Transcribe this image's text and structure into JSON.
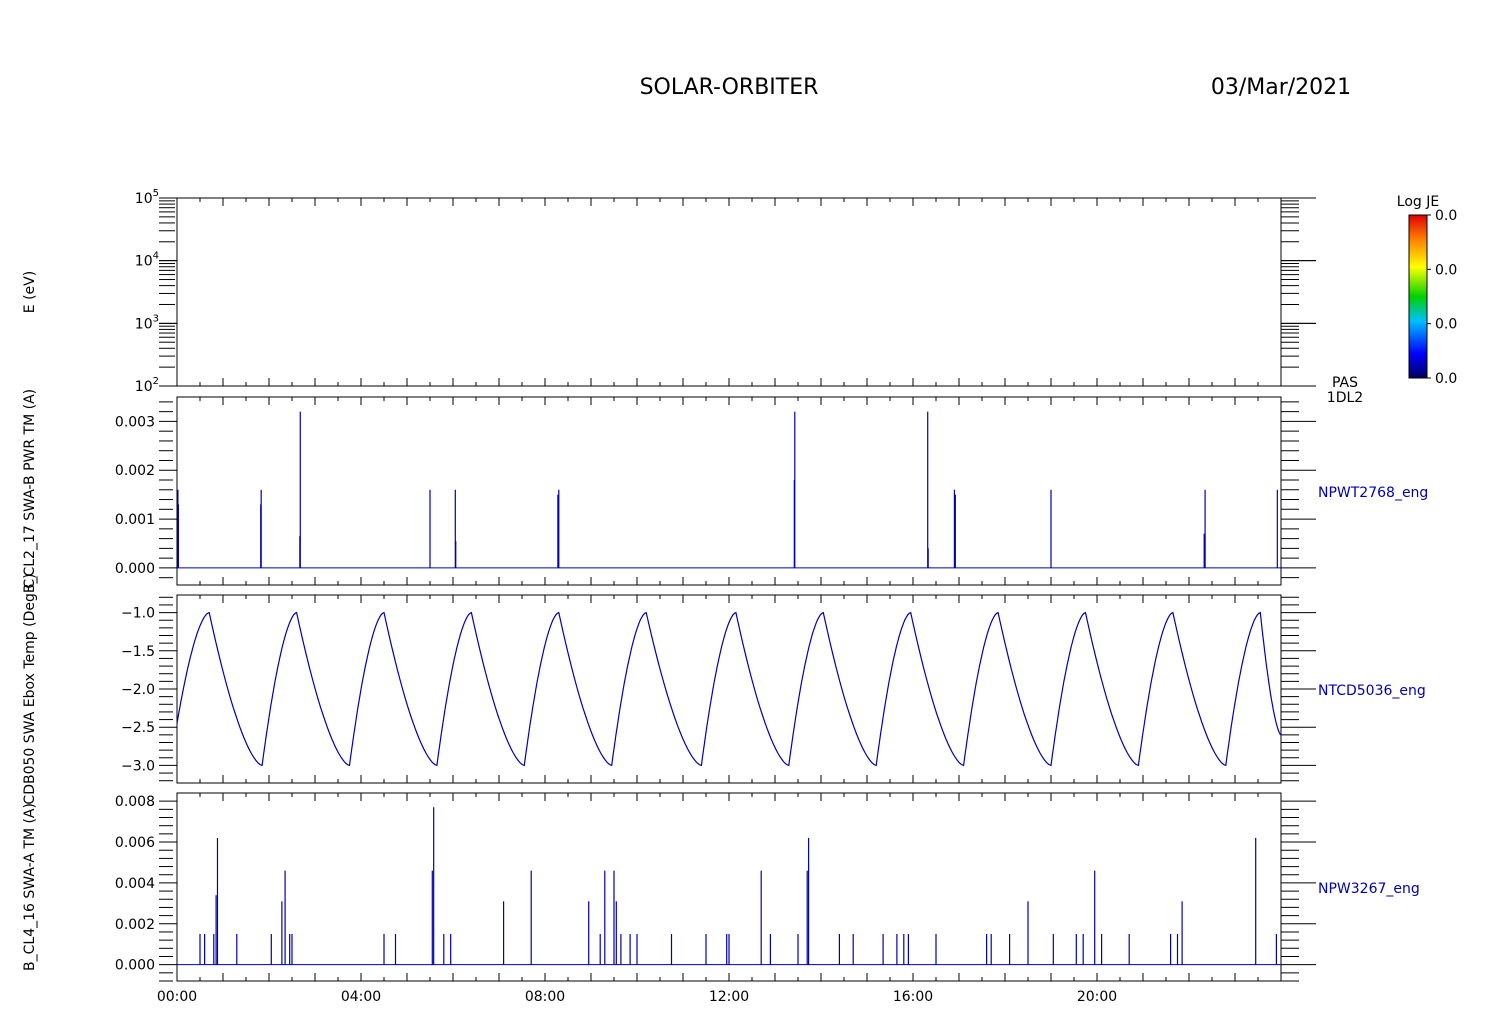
{
  "header": {
    "title": "SOLAR-ORBITER",
    "date": "03/Mar/2021"
  },
  "colors": {
    "series": "#0000b4",
    "axis": "#000000",
    "background": "#ffffff"
  },
  "chart_data": [
    {
      "type": "heatmap",
      "ylabel": "E (eV)",
      "yscale": "log",
      "ylim": [
        100,
        100000
      ],
      "ytick_labels": [
        {
          "base": "10",
          "exp": "2"
        },
        {
          "base": "10",
          "exp": "3"
        },
        {
          "base": "10",
          "exp": "4"
        },
        {
          "base": "10",
          "exp": "5"
        }
      ],
      "instrument_label": [
        "PAS",
        "1DL2"
      ],
      "colorbar": {
        "title": "Log JE",
        "tick_labels": [
          "0.0",
          "0.0",
          "0.0",
          "0.0"
        ]
      },
      "values": []
    },
    {
      "type": "line",
      "ylabel": "B_CL2_17 SWA-B PWR TM (A)",
      "series_name": "NPWT2768_eng",
      "ylim": [
        -0.00035,
        0.0035
      ],
      "yticks": [
        0.0,
        0.001,
        0.002,
        0.003
      ],
      "ytick_labels": [
        "0.000",
        "0.001",
        "0.002",
        "0.003"
      ],
      "baseline": 0.0,
      "spikes": [
        {
          "t": 0.02,
          "v": 0.0016
        },
        {
          "t": 0.03,
          "v": 0.0013
        },
        {
          "t": 1.83,
          "v": 0.0016
        },
        {
          "t": 1.82,
          "v": 0.0013
        },
        {
          "t": 2.68,
          "v": 0.0032
        },
        {
          "t": 2.67,
          "v": 0.00065
        },
        {
          "t": 5.5,
          "v": 0.0016
        },
        {
          "t": 6.05,
          "v": 0.0016
        },
        {
          "t": 6.06,
          "v": 0.00055
        },
        {
          "t": 8.3,
          "v": 0.0016
        },
        {
          "t": 8.28,
          "v": 0.0015
        },
        {
          "t": 13.43,
          "v": 0.0032
        },
        {
          "t": 13.42,
          "v": 0.0018
        },
        {
          "t": 16.32,
          "v": 0.0032
        },
        {
          "t": 16.33,
          "v": 0.0004
        },
        {
          "t": 16.9,
          "v": 0.0016
        },
        {
          "t": 16.92,
          "v": 0.0015
        },
        {
          "t": 19.0,
          "v": 0.0016
        },
        {
          "t": 22.35,
          "v": 0.0016
        },
        {
          "t": 22.33,
          "v": 0.0007
        },
        {
          "t": 23.92,
          "v": 0.0016
        }
      ]
    },
    {
      "type": "line",
      "ylabel": "CDB050 SWA Ebox Temp (Deg C)",
      "series_name": "NTCD5036_eng",
      "ylim": [
        -3.23,
        -0.77
      ],
      "yticks": [
        -3.0,
        -2.5,
        -2.0,
        -1.5,
        -1.0
      ],
      "ytick_labels": [
        "−3.0",
        "−2.5",
        "−2.0",
        "−1.5",
        "−1.0"
      ],
      "start": {
        "t": 0.0,
        "v": -2.45
      },
      "end": {
        "t": 24.0,
        "v": -2.6
      },
      "peaks": [
        {
          "t": 0.7,
          "v": -1.0
        },
        {
          "t": 2.6,
          "v": -1.0
        },
        {
          "t": 4.5,
          "v": -1.0
        },
        {
          "t": 6.4,
          "v": -1.0
        },
        {
          "t": 8.3,
          "v": -1.0
        },
        {
          "t": 10.2,
          "v": -1.0
        },
        {
          "t": 12.15,
          "v": -1.0
        },
        {
          "t": 14.05,
          "v": -1.0
        },
        {
          "t": 15.95,
          "v": -1.0
        },
        {
          "t": 17.85,
          "v": -1.0
        },
        {
          "t": 19.75,
          "v": -1.0
        },
        {
          "t": 21.65,
          "v": -1.0
        },
        {
          "t": 23.55,
          "v": -1.0
        }
      ],
      "troughs": [
        {
          "t": 1.85,
          "v": -3.0
        },
        {
          "t": 3.75,
          "v": -3.0
        },
        {
          "t": 5.65,
          "v": -3.0
        },
        {
          "t": 7.55,
          "v": -3.0
        },
        {
          "t": 9.45,
          "v": -3.0
        },
        {
          "t": 11.4,
          "v": -3.0
        },
        {
          "t": 13.3,
          "v": -3.0
        },
        {
          "t": 15.2,
          "v": -3.0
        },
        {
          "t": 17.1,
          "v": -3.0
        },
        {
          "t": 19.0,
          "v": -3.0
        },
        {
          "t": 20.9,
          "v": -3.0
        },
        {
          "t": 22.8,
          "v": -3.0
        }
      ]
    },
    {
      "type": "line",
      "ylabel": "B_CL4_16 SWA-A TM (A)",
      "series_name": "NPW3267_eng",
      "ylim": [
        -0.0008,
        0.0084
      ],
      "yticks": [
        0.0,
        0.002,
        0.004,
        0.006,
        0.008
      ],
      "ytick_labels": [
        "0.000",
        "0.002",
        "0.004",
        "0.006",
        "0.008"
      ],
      "baseline": 0.0,
      "spikes": [
        {
          "t": 0.5,
          "v": 0.0015
        },
        {
          "t": 0.6,
          "v": 0.0015
        },
        {
          "t": 0.8,
          "v": 0.0015
        },
        {
          "t": 0.85,
          "v": 0.0034
        },
        {
          "t": 0.88,
          "v": 0.0062
        },
        {
          "t": 1.3,
          "v": 0.0015
        },
        {
          "t": 2.05,
          "v": 0.0015
        },
        {
          "t": 2.28,
          "v": 0.0031
        },
        {
          "t": 2.35,
          "v": 0.0046
        },
        {
          "t": 2.45,
          "v": 0.0015
        },
        {
          "t": 2.5,
          "v": 0.0015
        },
        {
          "t": 4.5,
          "v": 0.0015
        },
        {
          "t": 4.75,
          "v": 0.0015
        },
        {
          "t": 5.55,
          "v": 0.0046
        },
        {
          "t": 5.58,
          "v": 0.0077
        },
        {
          "t": 5.8,
          "v": 0.0015
        },
        {
          "t": 5.95,
          "v": 0.0015
        },
        {
          "t": 7.1,
          "v": 0.0031
        },
        {
          "t": 7.7,
          "v": 0.0046
        },
        {
          "t": 8.95,
          "v": 0.0031
        },
        {
          "t": 9.2,
          "v": 0.0015
        },
        {
          "t": 9.3,
          "v": 0.0046
        },
        {
          "t": 9.5,
          "v": 0.0046
        },
        {
          "t": 9.55,
          "v": 0.0031
        },
        {
          "t": 9.65,
          "v": 0.0015
        },
        {
          "t": 9.85,
          "v": 0.0015
        },
        {
          "t": 10.0,
          "v": 0.0015
        },
        {
          "t": 10.75,
          "v": 0.0015
        },
        {
          "t": 11.5,
          "v": 0.0015
        },
        {
          "t": 11.95,
          "v": 0.0015
        },
        {
          "t": 12.0,
          "v": 0.0015
        },
        {
          "t": 12.7,
          "v": 0.0046
        },
        {
          "t": 12.9,
          "v": 0.0015
        },
        {
          "t": 13.5,
          "v": 0.0015
        },
        {
          "t": 13.7,
          "v": 0.0046
        },
        {
          "t": 13.73,
          "v": 0.0062
        },
        {
          "t": 14.4,
          "v": 0.0015
        },
        {
          "t": 14.7,
          "v": 0.0015
        },
        {
          "t": 15.35,
          "v": 0.0015
        },
        {
          "t": 15.65,
          "v": 0.0015
        },
        {
          "t": 15.8,
          "v": 0.0015
        },
        {
          "t": 15.9,
          "v": 0.0015
        },
        {
          "t": 16.5,
          "v": 0.0015
        },
        {
          "t": 17.6,
          "v": 0.0015
        },
        {
          "t": 17.7,
          "v": 0.0015
        },
        {
          "t": 18.1,
          "v": 0.0015
        },
        {
          "t": 18.5,
          "v": 0.0031
        },
        {
          "t": 19.05,
          "v": 0.0015
        },
        {
          "t": 19.55,
          "v": 0.0015
        },
        {
          "t": 19.7,
          "v": 0.0015
        },
        {
          "t": 19.95,
          "v": 0.0046
        },
        {
          "t": 20.1,
          "v": 0.0015
        },
        {
          "t": 20.7,
          "v": 0.0015
        },
        {
          "t": 21.6,
          "v": 0.0015
        },
        {
          "t": 21.75,
          "v": 0.0015
        },
        {
          "t": 21.85,
          "v": 0.0031
        },
        {
          "t": 23.45,
          "v": 0.0062
        },
        {
          "t": 23.9,
          "v": 0.0015
        }
      ]
    }
  ],
  "xaxis": {
    "xlim": [
      0,
      24
    ],
    "tick_labels": [
      "00:00",
      "04:00",
      "08:00",
      "12:00",
      "16:00",
      "20:00"
    ],
    "tick_hours": [
      0,
      4,
      8,
      12,
      16,
      20
    ]
  }
}
